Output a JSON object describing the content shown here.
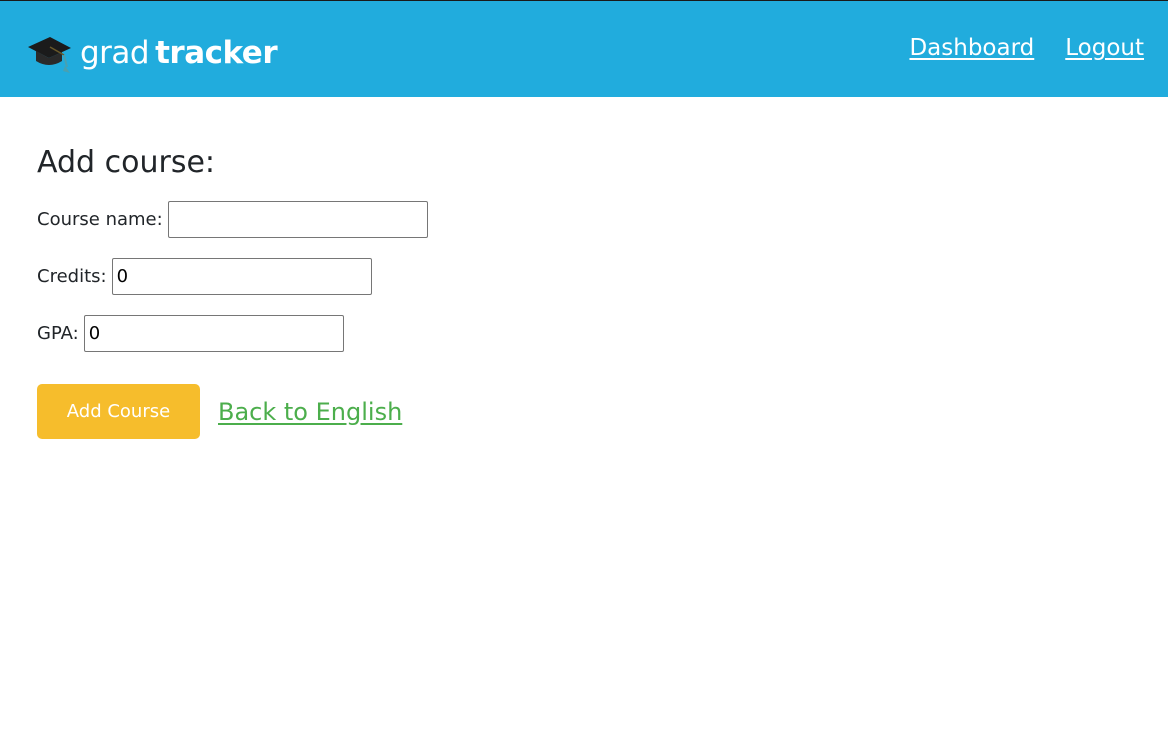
{
  "header": {
    "brand_light": "grad",
    "brand_bold": "tracker",
    "logo_icon": "graduation-cap-icon",
    "nav": [
      {
        "label": "Dashboard"
      },
      {
        "label": "Logout"
      }
    ]
  },
  "form": {
    "title": "Add course:",
    "fields": [
      {
        "label": "Course name:",
        "value": ""
      },
      {
        "label": "Credits:",
        "value": "0"
      },
      {
        "label": "GPA:",
        "value": "0"
      }
    ],
    "submit_label": "Add Course",
    "back_label": "Back to English"
  },
  "colors": {
    "navbar": "#21acdd",
    "button": "#f6bd2c",
    "link": "#4cae4c"
  }
}
